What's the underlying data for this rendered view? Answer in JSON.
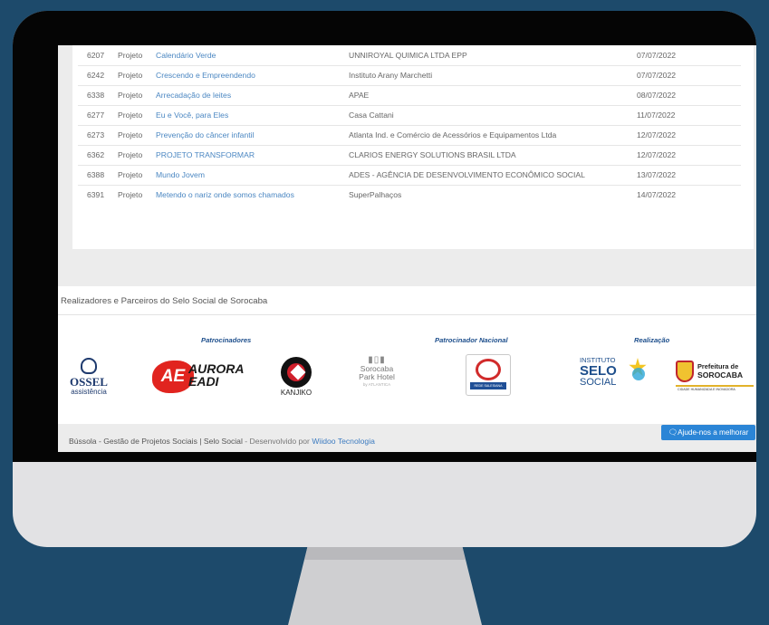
{
  "projects": [
    {
      "id": "6207",
      "type": "Projeto",
      "name": "Calendário Verde",
      "org": "UNNIROYAL QUIMICA LTDA EPP",
      "date": "07/07/2022"
    },
    {
      "id": "6242",
      "type": "Projeto",
      "name": "Crescendo e Empreendendo",
      "org": "Instituto Arany Marchetti",
      "date": "07/07/2022"
    },
    {
      "id": "6338",
      "type": "Projeto",
      "name": "Arrecadação de leites",
      "org": "APAE",
      "date": "08/07/2022"
    },
    {
      "id": "6277",
      "type": "Projeto",
      "name": "Eu e Você, para Eles",
      "org": "Casa Cattani",
      "date": "11/07/2022"
    },
    {
      "id": "6273",
      "type": "Projeto",
      "name": "Prevenção do câncer infantil",
      "org": "Atlanta Ind. e Comércio de Acessórios e Equipamentos Ltda",
      "date": "12/07/2022"
    },
    {
      "id": "6362",
      "type": "Projeto",
      "name": "PROJETO TRANSFORMAR",
      "org": "CLARIOS ENERGY SOLUTIONS BRASIL LTDA",
      "date": "12/07/2022"
    },
    {
      "id": "6388",
      "type": "Projeto",
      "name": "Mundo Jovem",
      "org": "ADES - AGÊNCIA DE DESENVOLVIMENTO ECONÔMICO SOCIAL",
      "date": "13/07/2022"
    },
    {
      "id": "6391",
      "type": "Projeto",
      "name": "Metendo o nariz onde somos chamados",
      "org": "SuperPalhaços",
      "date": "14/07/2022"
    }
  ],
  "partners": {
    "heading": "Realizadores e Parceiros do Selo Social de Sorocaba",
    "categories": {
      "sponsors": "Patrocinadores",
      "national": "Patrocinador Nacional",
      "realization": "Realização"
    },
    "logos": {
      "ossel": {
        "name": "OSSEL",
        "sub": "assistência"
      },
      "aurora": {
        "mark": "AE",
        "line1": "AURORA",
        "line2": "EADI"
      },
      "kanjiko": {
        "name": "KANJIKO"
      },
      "park_hotel": {
        "line1": "Sorocaba",
        "line2": "Park Hotel",
        "sub": "by ATLANTICA"
      },
      "rede": {
        "name": "REDE SALESIANA BRASIL"
      },
      "selo": {
        "line1": "INSTITUTO",
        "line2": "SELO",
        "line3": "SOCIAL"
      },
      "prefeitura": {
        "line1": "Prefeitura de",
        "line2": "SOROCABA",
        "tagline": "CIDADE HUMANIZADA E INOVADORA"
      }
    }
  },
  "footer": {
    "brand": "Bússola - Gestão de Projetos Sociais | Selo Social",
    "developed_by": " - Desenvolvido por ",
    "developer": "Wiidoo Tecnologia",
    "help_button": "Ajude-nos a melhorar"
  },
  "colors": {
    "background": "#1d4a6b",
    "link": "#4b87c2",
    "help_button": "#2b85d6"
  }
}
